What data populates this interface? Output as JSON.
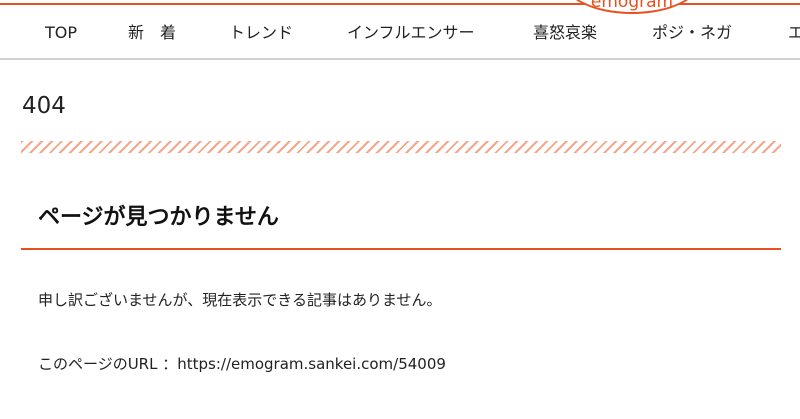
{
  "header": {
    "logo_text": "emogram",
    "nav_items": [
      {
        "label": "TOP"
      },
      {
        "label": "新　着"
      },
      {
        "label": "トレンド"
      },
      {
        "label": "インフルエンサー"
      },
      {
        "label": "喜怒哀楽"
      },
      {
        "label": "ポジ・ネガ"
      },
      {
        "label": "エ"
      }
    ]
  },
  "main": {
    "status_code": "404",
    "heading": "ページが見つかりません",
    "message": "申し訳ございませんが、現在表示できる記事はありません。",
    "url_label": "このページのURL ：",
    "url_value": "https://emogram.sankei.com/54009"
  },
  "colors": {
    "accent": "#e8501f",
    "hatch": "#f4a68a",
    "nav_border": "#d0d0d0"
  }
}
